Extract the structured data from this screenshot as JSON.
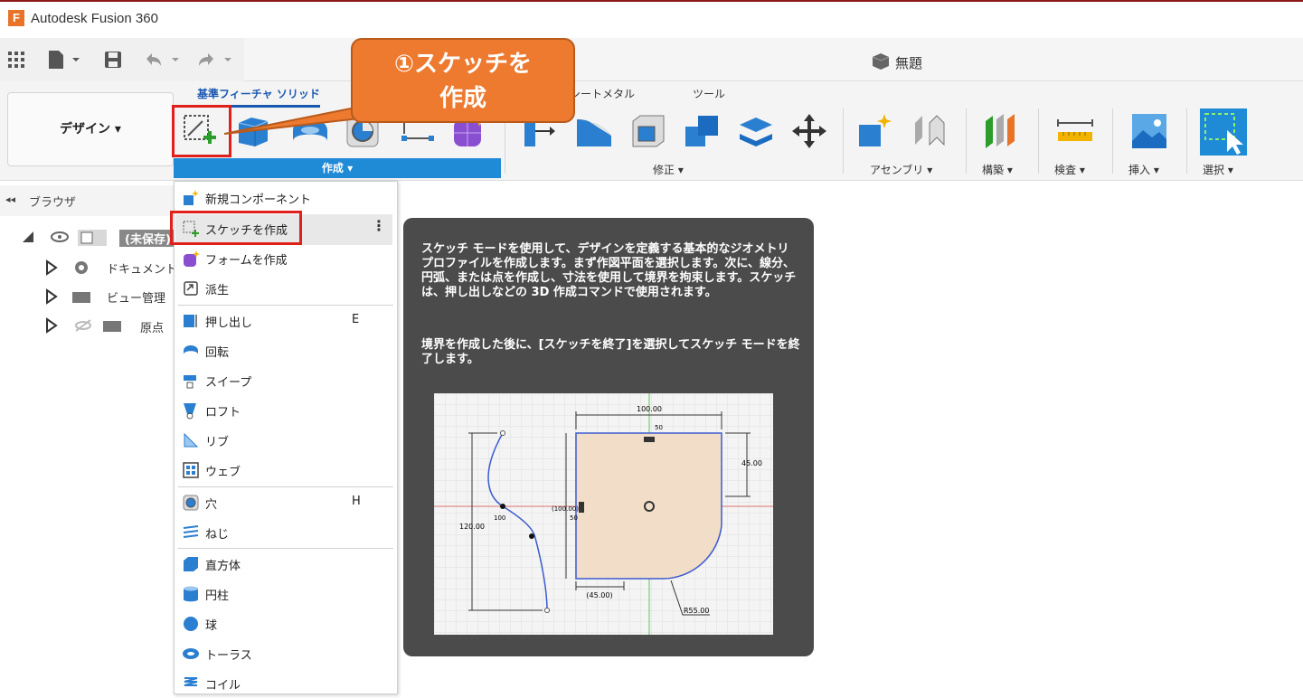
{
  "window": {
    "app_title": "Autodesk Fusion 360",
    "logo_letter": "F"
  },
  "document": {
    "title": "無題"
  },
  "workspace": {
    "label": "デザイン ▾"
  },
  "tabs": [
    {
      "label": "基準フィーチャ ソリッド"
    },
    {
      "label": "シートメタル"
    },
    {
      "label": "ツール"
    }
  ],
  "ribbon_groups": [
    {
      "label": "作成 ▾"
    },
    {
      "label": "修正 ▾"
    },
    {
      "label": "アセンブリ ▾"
    },
    {
      "label": "構築 ▾"
    },
    {
      "label": "検査 ▾"
    },
    {
      "label": "挿入 ▾"
    },
    {
      "label": "選択 ▾"
    }
  ],
  "callout": {
    "line1": "①スケッチを",
    "line2": "作成"
  },
  "browser": {
    "title": "ブラウザ",
    "collapse_glyph": "◂◂",
    "root_label": "(未保存)",
    "nodes": [
      {
        "label": "ドキュメントの"
      },
      {
        "label": "ビュー管理"
      },
      {
        "label": "原点"
      }
    ]
  },
  "menu": {
    "more_glyph": "⋮",
    "items": [
      {
        "label": "新規コンポーネント",
        "key": ""
      },
      {
        "label": "スケッチを作成",
        "key": ""
      },
      {
        "label": "フォームを作成",
        "key": ""
      },
      {
        "label": "派生",
        "key": ""
      },
      {
        "label": "押し出し",
        "key": "E"
      },
      {
        "label": "回転",
        "key": ""
      },
      {
        "label": "スイープ",
        "key": ""
      },
      {
        "label": "ロフト",
        "key": ""
      },
      {
        "label": "リブ",
        "key": ""
      },
      {
        "label": "ウェブ",
        "key": ""
      },
      {
        "label": "穴",
        "key": "H"
      },
      {
        "label": "ねじ",
        "key": ""
      },
      {
        "label": "直方体",
        "key": ""
      },
      {
        "label": "円柱",
        "key": ""
      },
      {
        "label": "球",
        "key": ""
      },
      {
        "label": "トーラス",
        "key": ""
      },
      {
        "label": "コイル",
        "key": ""
      }
    ]
  },
  "tooltip": {
    "para1": "スケッチ モードを使用して、デザインを定義する基本的なジオメトリ プロファイルを作成します。まず作図平面を選択します。次に、線分、円弧、または点を作成し、寸法を使用して境界を拘束します。スケッチは、押し出しなどの 3D 作成コマンドで使用されます。",
    "para2": "境界を作成した後に、[スケッチを終了]を選択してスケッチ モードを終了します。",
    "dims": {
      "top": "100.00",
      "small_top": "50",
      "right": "45.00",
      "left_inner": "(100.00)",
      "left_inner2": "50",
      "curve": "100",
      "left": "120.00",
      "bottom": "(45.00)",
      "radius": "R55.00"
    }
  },
  "colors": {
    "accent": "#1f8ad6",
    "callout": "#ed7a2f",
    "highlight": "#e0201a",
    "tooltip_bg": "#4b4b4b"
  }
}
